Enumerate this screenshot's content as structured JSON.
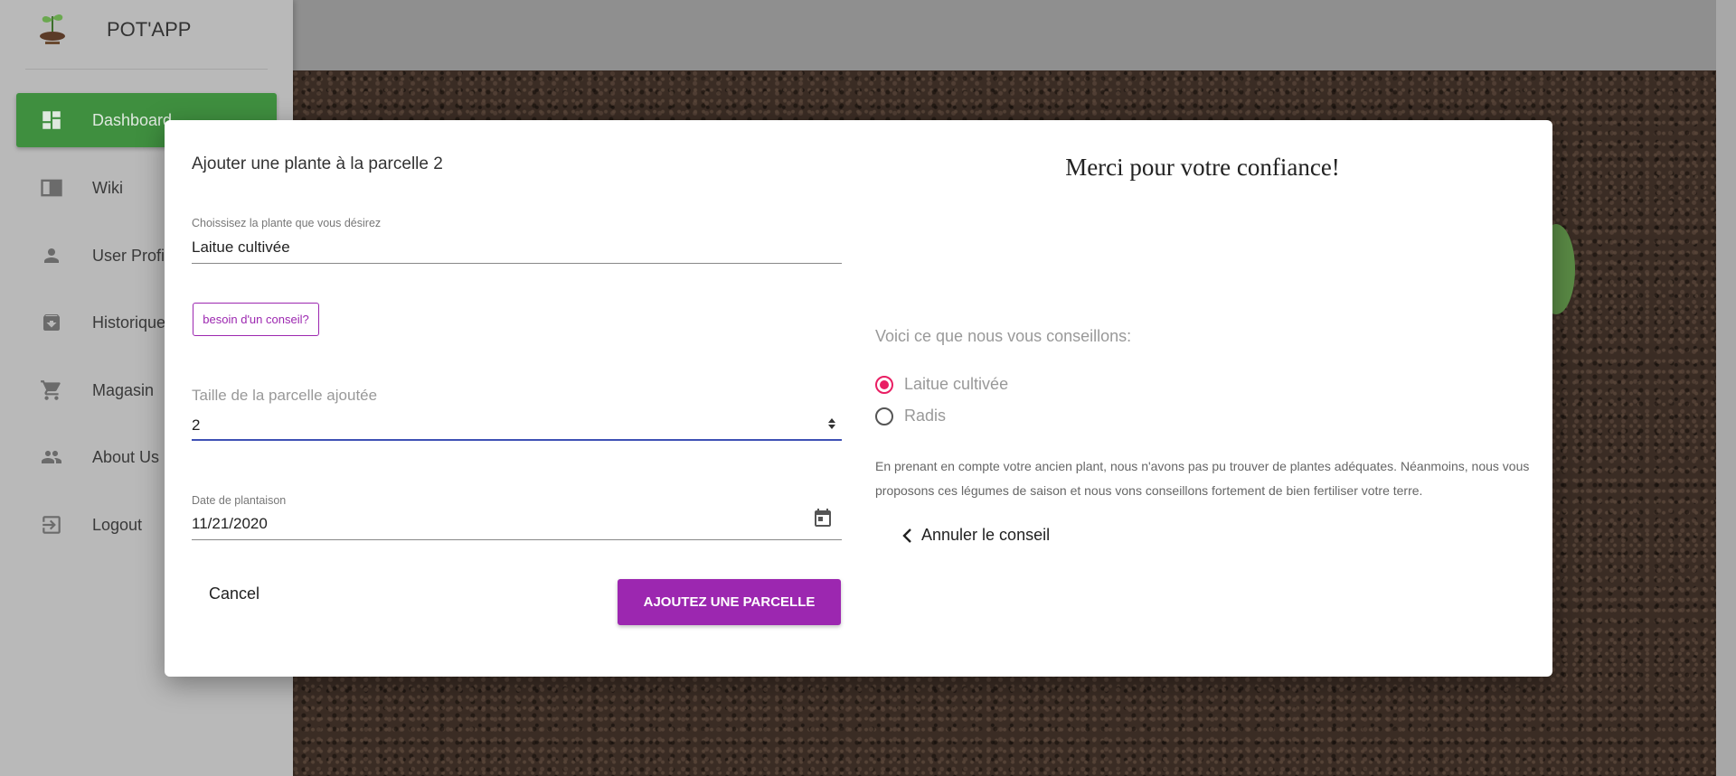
{
  "app": {
    "name": "POT'APP"
  },
  "sidebar": {
    "items": [
      {
        "label": "Dashboard",
        "icon": "dashboard-icon",
        "active": true
      },
      {
        "label": "Wiki",
        "icon": "wiki-icon",
        "active": false
      },
      {
        "label": "User Profile",
        "icon": "person-icon",
        "active": false
      },
      {
        "label": "Historique",
        "icon": "archive-icon",
        "active": false
      },
      {
        "label": "Magasin",
        "icon": "cart-icon",
        "active": false
      },
      {
        "label": "About Us",
        "icon": "people-icon",
        "active": false
      },
      {
        "label": "Logout",
        "icon": "logout-icon",
        "active": false
      }
    ]
  },
  "dialog": {
    "title": "Ajouter une plante à la parcelle 2",
    "plant_field": {
      "label": "Choissisez la plante que vous désirez",
      "value": "Laitue cultivée"
    },
    "conseil_button": "besoin d'un conseil?",
    "taille_field": {
      "label": "Taille de la parcelle ajoutée",
      "value": "2"
    },
    "date_field": {
      "label": "Date de plantaison",
      "value": "11/21/2020"
    },
    "cancel_label": "Cancel",
    "submit_label": "AJOUTEZ UNE PARCELLE",
    "advice_panel": {
      "heading": "Merci pour votre confiance!",
      "subheading": "Voici ce que nous vous conseillons:",
      "options": [
        {
          "label": "Laitue cultivée",
          "selected": true
        },
        {
          "label": "Radis",
          "selected": false
        }
      ],
      "text": "En prenant en compte votre ancien plant, nous n'avons pas pu trouver de plantes adéquates. Néanmoins, nous vous proposons ces légumes de saison et nous vons conseillons fortement de bien fertiliser votre terre.",
      "cancel_advice": "Annuler le conseil"
    }
  },
  "colors": {
    "primary": "#9c27b0",
    "active_nav": "#3f8f3f",
    "radio_selected": "#e91e63"
  }
}
